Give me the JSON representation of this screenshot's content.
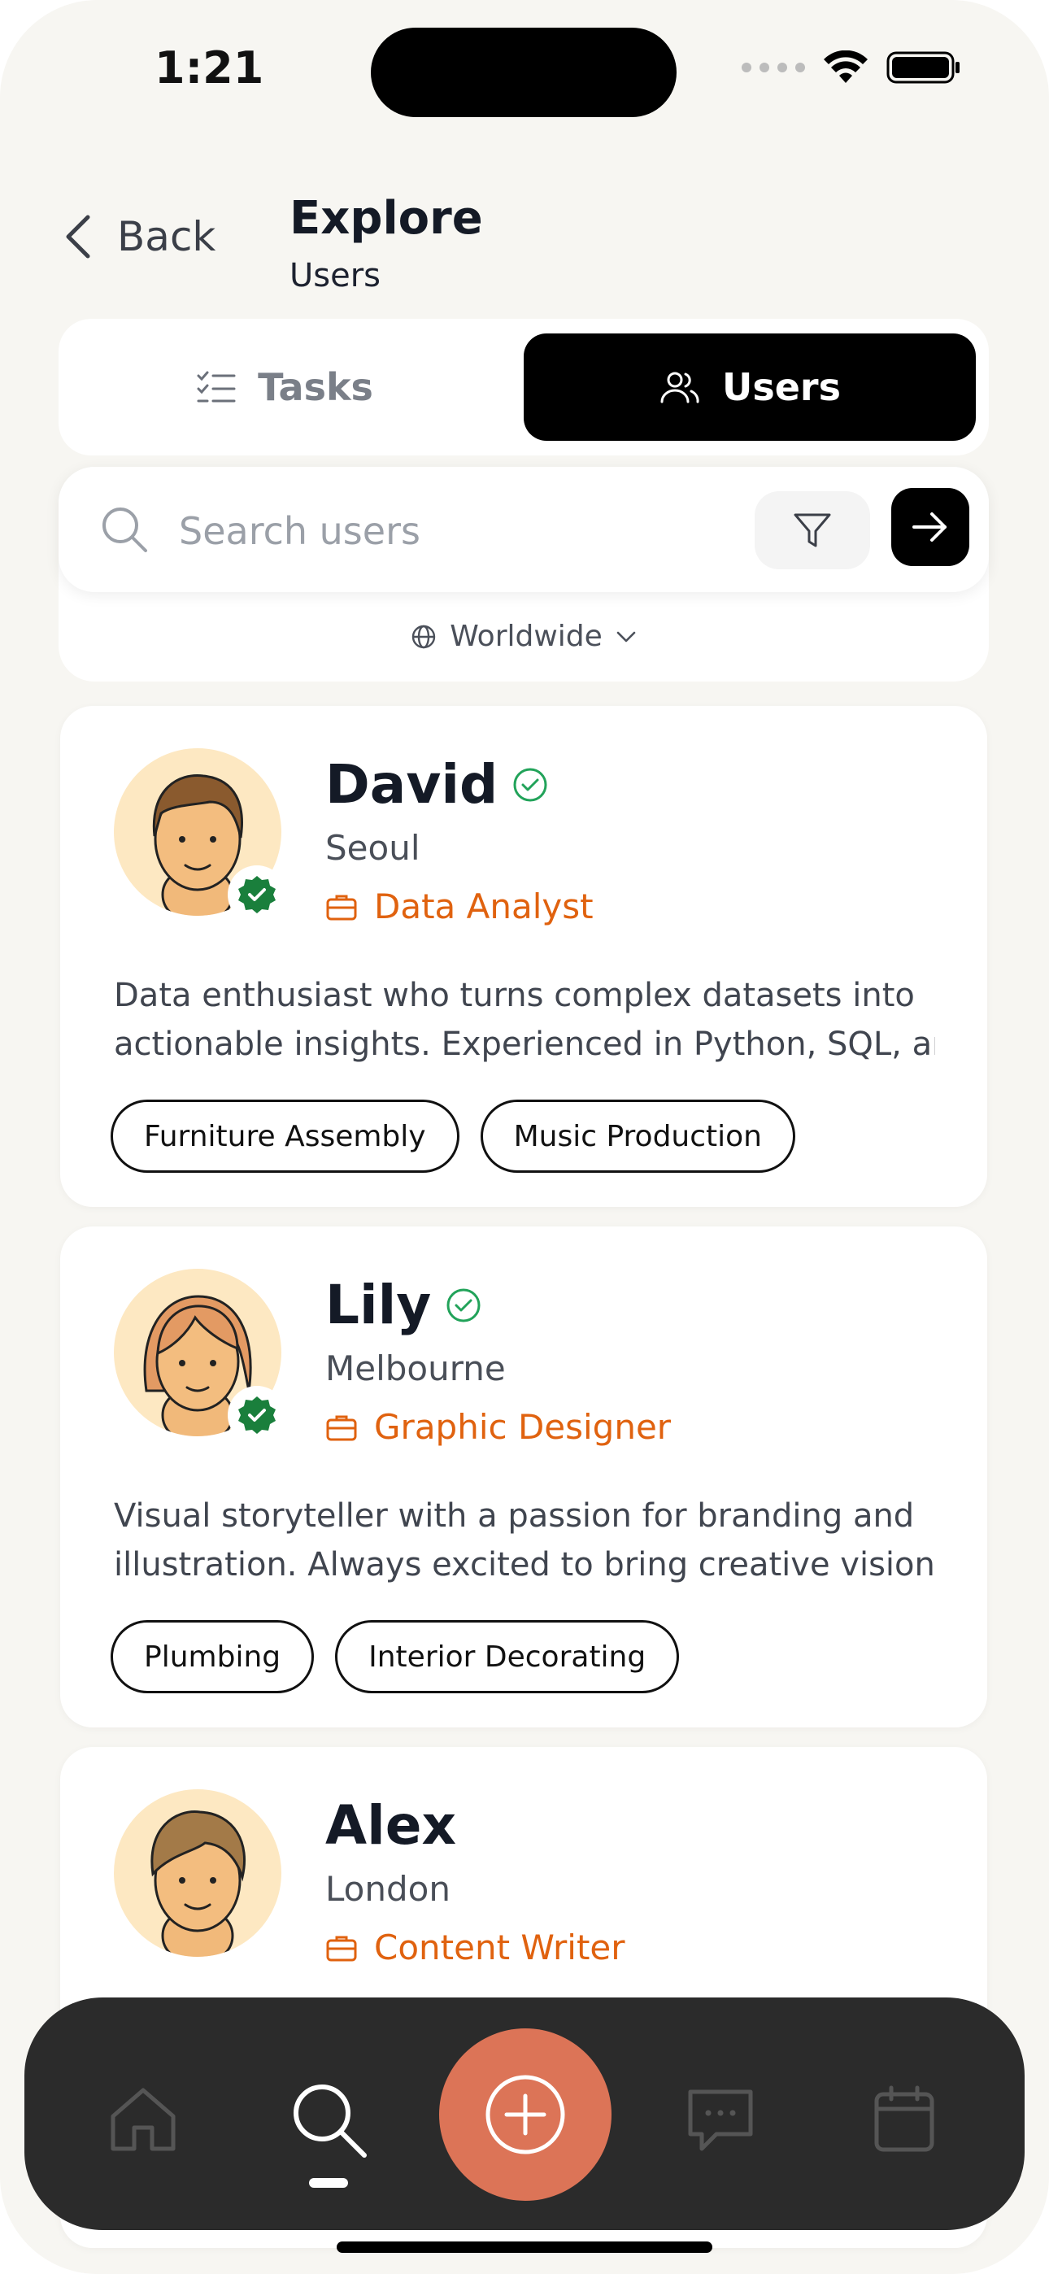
{
  "status_bar": {
    "time": "1:21"
  },
  "header": {
    "back_label": "Back",
    "title": "Explore",
    "subtitle": "Users"
  },
  "segmented": {
    "tabs": [
      {
        "label": "Tasks",
        "icon": "checklist-icon"
      },
      {
        "label": "Users",
        "icon": "users-icon",
        "selected": true
      }
    ]
  },
  "search": {
    "placeholder": "Search users",
    "region": "Worldwide"
  },
  "users": [
    {
      "name": "David",
      "verified": true,
      "city": "Seoul",
      "role": "Data Analyst",
      "bio_line1": "Data enthusiast who turns complex datasets into",
      "bio_line2": "actionable insights. Experienced in Python, SQL, and r",
      "tags": [
        "Furniture Assembly",
        "Music Production"
      ]
    },
    {
      "name": "Lily",
      "verified": true,
      "city": "Melbourne",
      "role": "Graphic Designer",
      "bio_line1": "Visual storyteller with a passion for branding and",
      "bio_line2": "illustration. Always excited to bring creative visions tc",
      "tags": [
        "Plumbing",
        "Interior Decorating"
      ]
    },
    {
      "name": "Alex",
      "verified": false,
      "city": "London",
      "role": "Content Writer"
    }
  ],
  "bottom_nav": {
    "items": [
      "home-icon",
      "search-icon",
      "add-icon",
      "chat-icon",
      "calendar-icon"
    ],
    "active": "search-icon"
  },
  "colors": {
    "accent_orange": "#e0620f",
    "fab": "#dc7457",
    "verified_green": "#22a35a",
    "badge_green": "#1a7f3c"
  }
}
